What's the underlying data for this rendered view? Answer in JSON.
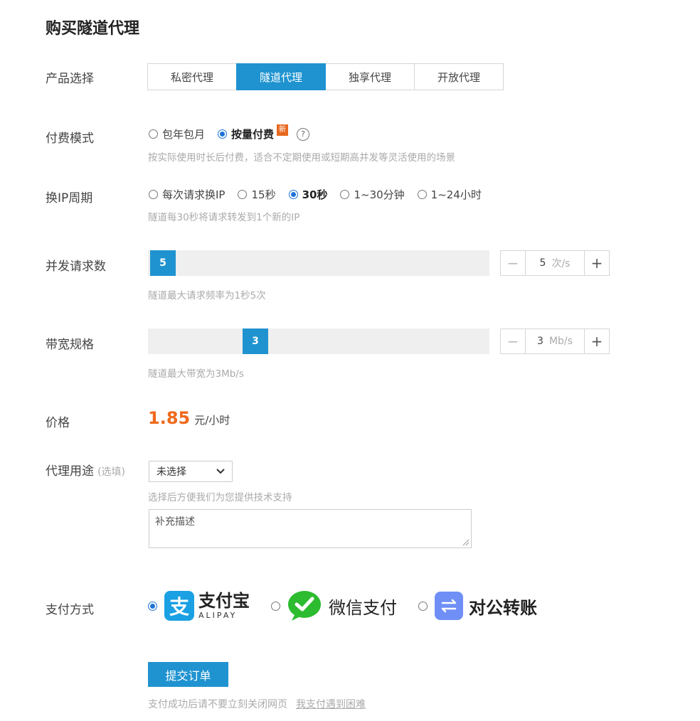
{
  "page_title": "购买隧道代理",
  "product": {
    "label": "产品选择",
    "tabs": [
      "私密代理",
      "隧道代理",
      "独享代理",
      "开放代理"
    ],
    "active_index": 1
  },
  "billing": {
    "label": "付费模式",
    "options": [
      "包年包月",
      "按量付费"
    ],
    "selected_index": 1,
    "new_badge": "新",
    "help_glyph": "?",
    "hint": "按实际使用时长后付费，适合不定期使用或短期高并发等灵活使用的场景"
  },
  "ip_cycle": {
    "label": "换IP周期",
    "options": [
      "每次请求换IP",
      "15秒",
      "30秒",
      "1~30分钟",
      "1~24小时"
    ],
    "selected_index": 2,
    "hint": "隧道每30秒将请求转发到1个新的IP"
  },
  "concurrency": {
    "label": "并发请求数",
    "value": "5",
    "unit": "次/s",
    "hint": "隧道最大请求频率为1秒5次"
  },
  "bandwidth": {
    "label": "带宽规格",
    "value": "3",
    "unit": "Mb/s",
    "hint": "隧道最大带宽为3Mb/s"
  },
  "price": {
    "label": "价格",
    "amount": "1.85",
    "unit": "元/小时"
  },
  "usage": {
    "label": "代理用途",
    "optional": "(选填)",
    "select_value": "未选择",
    "hint": "选择后方便我们为您提供技术支持",
    "textarea_placeholder": "补充描述"
  },
  "payment": {
    "label": "支付方式",
    "alipay_cn": "支付宝",
    "alipay_en": "ALIPAY",
    "wechat": "微信支付",
    "transfer": "对公转账",
    "selected_index": 0
  },
  "colors": {
    "primary": "#1f93d0",
    "price": "#ee6a1d",
    "alipay": "#1aa0e3",
    "wechat": "#2dbb30",
    "transfer": "#6f8ff6"
  },
  "submit_label": "提交订单",
  "footer_note": "支付成功后请不要立刻关闭网页",
  "footer_link": "我支付遇到困难"
}
